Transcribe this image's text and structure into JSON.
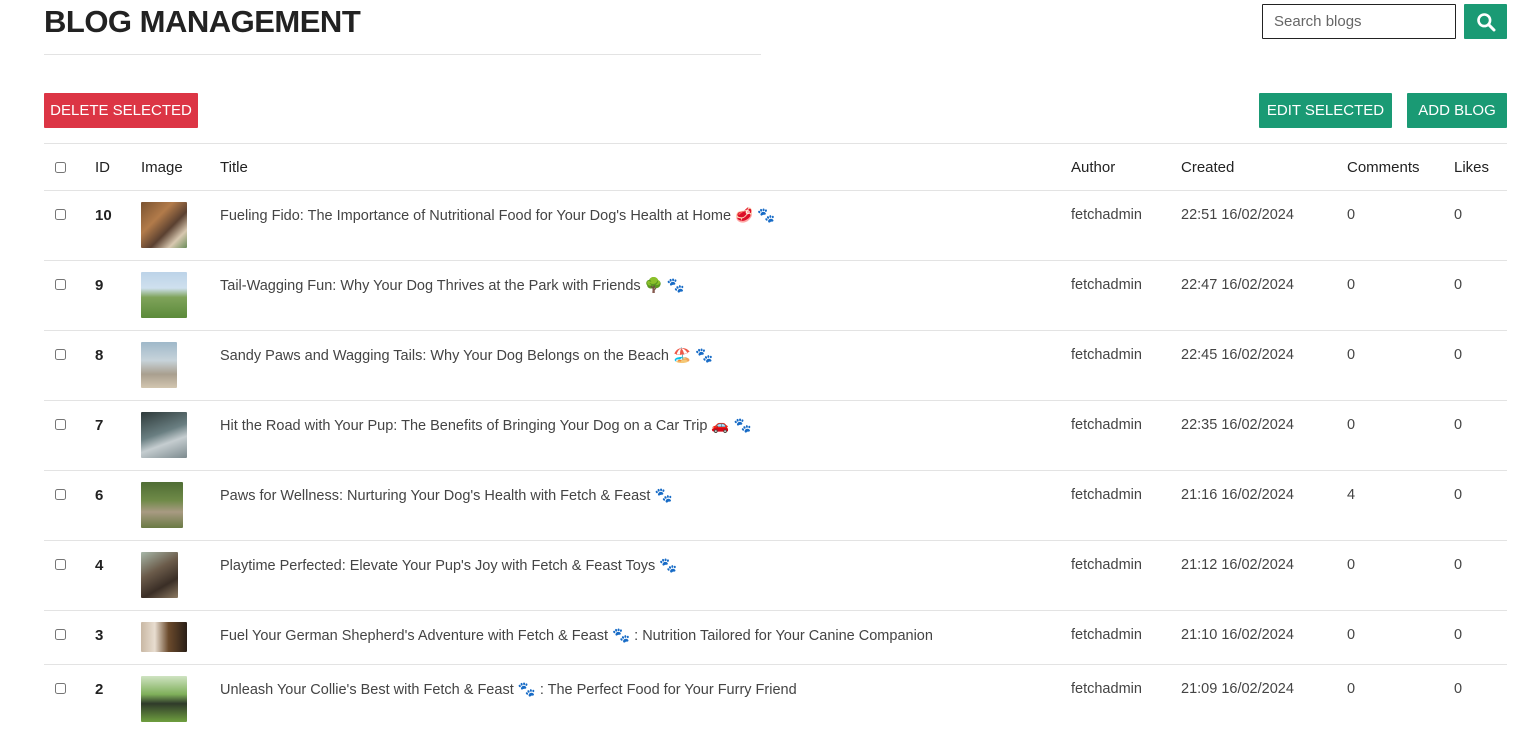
{
  "header": {
    "title": "BLOG MANAGEMENT",
    "search_placeholder": "Search blogs",
    "search_icon": "search-icon"
  },
  "toolbar": {
    "delete_label": "DELETE SELECTED",
    "edit_label": "EDIT SELECTED",
    "add_label": "ADD BLOG"
  },
  "colors": {
    "accent": "#1a9a74",
    "danger": "#dc3545"
  },
  "table": {
    "columns": [
      "ID",
      "Image",
      "Title",
      "Author",
      "Created",
      "Comments",
      "Likes"
    ],
    "rows": [
      {
        "id": "10",
        "title": "Fueling Fido: The Importance of Nutritional Food for Your Dog's Health at Home 🥩 🐾",
        "author": "fetchadmin",
        "created": "22:51 16/02/2024",
        "comments": "0",
        "likes": "0"
      },
      {
        "id": "9",
        "title": "Tail-Wagging Fun: Why Your Dog Thrives at the Park with Friends 🌳 🐾",
        "author": "fetchadmin",
        "created": "22:47 16/02/2024",
        "comments": "0",
        "likes": "0"
      },
      {
        "id": "8",
        "title": "Sandy Paws and Wagging Tails: Why Your Dog Belongs on the Beach 🏖️ 🐾",
        "author": "fetchadmin",
        "created": "22:45 16/02/2024",
        "comments": "0",
        "likes": "0"
      },
      {
        "id": "7",
        "title": "Hit the Road with Your Pup: The Benefits of Bringing Your Dog on a Car Trip 🚗 🐾",
        "author": "fetchadmin",
        "created": "22:35 16/02/2024",
        "comments": "0",
        "likes": "0"
      },
      {
        "id": "6",
        "title": "Paws for Wellness: Nurturing Your Dog's Health with Fetch & Feast 🐾",
        "author": "fetchadmin",
        "created": "21:16 16/02/2024",
        "comments": "4",
        "likes": "0"
      },
      {
        "id": "4",
        "title": "Playtime Perfected: Elevate Your Pup's Joy with Fetch & Feast Toys 🐾",
        "author": "fetchadmin",
        "created": "21:12 16/02/2024",
        "comments": "0",
        "likes": "0"
      },
      {
        "id": "3",
        "title": "Fuel Your German Shepherd's Adventure with Fetch & Feast 🐾 : Nutrition Tailored for Your Canine Companion",
        "author": "fetchadmin",
        "created": "21:10 16/02/2024",
        "comments": "0",
        "likes": "0"
      },
      {
        "id": "2",
        "title": "Unleash Your Collie's Best with Fetch & Feast 🐾 : The Perfect Food for Your Furry Friend",
        "author": "fetchadmin",
        "created": "21:09 16/02/2024",
        "comments": "0",
        "likes": "0"
      }
    ]
  }
}
